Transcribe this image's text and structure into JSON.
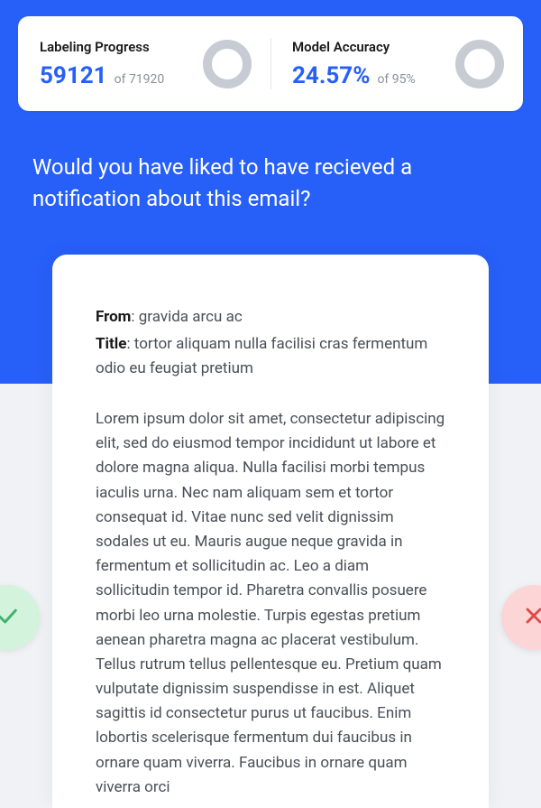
{
  "stats": {
    "progress": {
      "label": "Labeling Progress",
      "value": "59121",
      "of_prefix": "of",
      "total": "71920"
    },
    "accuracy": {
      "label": "Model Accuracy",
      "value": "24.57%",
      "of_prefix": "of",
      "target": "95%"
    }
  },
  "question": "Would you have liked to have recieved a notification about this email?",
  "email": {
    "from_label": "From",
    "from_value": ": gravida arcu ac",
    "title_label": "Title",
    "title_value": ": tortor aliquam nulla facilisi cras fermentum odio eu feugiat pretium",
    "body": "Lorem ipsum dolor sit amet, consectetur adipiscing elit, sed do eiusmod tempor incididunt ut labore et dolore magna aliqua. Nulla facilisi morbi tempus iaculis urna. Nec nam aliquam sem et tortor consequat id. Vitae nunc sed velit dignissim sodales ut eu. Mauris augue neque gravida in fermentum et sollicitudin ac. Leo a diam sollicitudin tempor id. Pharetra convallis posuere morbi leo urna molestie. Turpis egestas pretium aenean pharetra magna ac placerat vestibulum. Tellus rutrum tellus pellentesque eu. Pretium quam vulputate dignissim suspendisse in est. Aliquet sagittis id consectetur purus ut faucibus. Enim lobortis scelerisque fermentum dui faucibus in ornare quam viverra. Faucibus in ornare quam viverra orci"
  },
  "colors": {
    "primary": "#2760f8",
    "ring": "#c7ccd4",
    "yes": "#3fb36a",
    "no": "#e14848"
  }
}
